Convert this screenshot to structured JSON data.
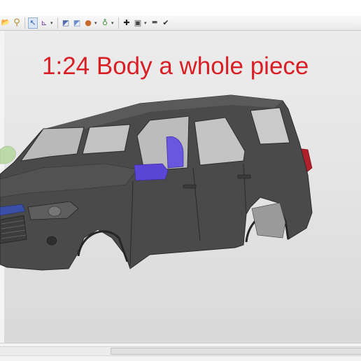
{
  "toolbar": {
    "icons": [
      "folder-icon",
      "search-icon",
      "select-arrow-icon",
      "axis-icon",
      "shading-icon",
      "sphere-icon",
      "globe-icon",
      "add-icon",
      "camera-icon",
      "minus-icon",
      "checkmark-icon"
    ],
    "glyphs": {
      "folder": "📂",
      "search": "⚲",
      "select": "↖",
      "axis": "⊾",
      "dropdown": "▾",
      "shading": "◩",
      "sphere": "●",
      "globe": "♁",
      "add": "✚",
      "camera": "▣",
      "minus": "▬",
      "check": "✔"
    }
  },
  "viewport": {
    "headline": "1:24 Body a whole piece",
    "headline_color": "#d81f26",
    "model_body_color": "#4a4a4a",
    "seat_color": "#5b45d6",
    "grille_accent_color": "#3a4fa8",
    "taillight_color": "#b0202a",
    "helper_object_color": "#bcd9a8"
  }
}
